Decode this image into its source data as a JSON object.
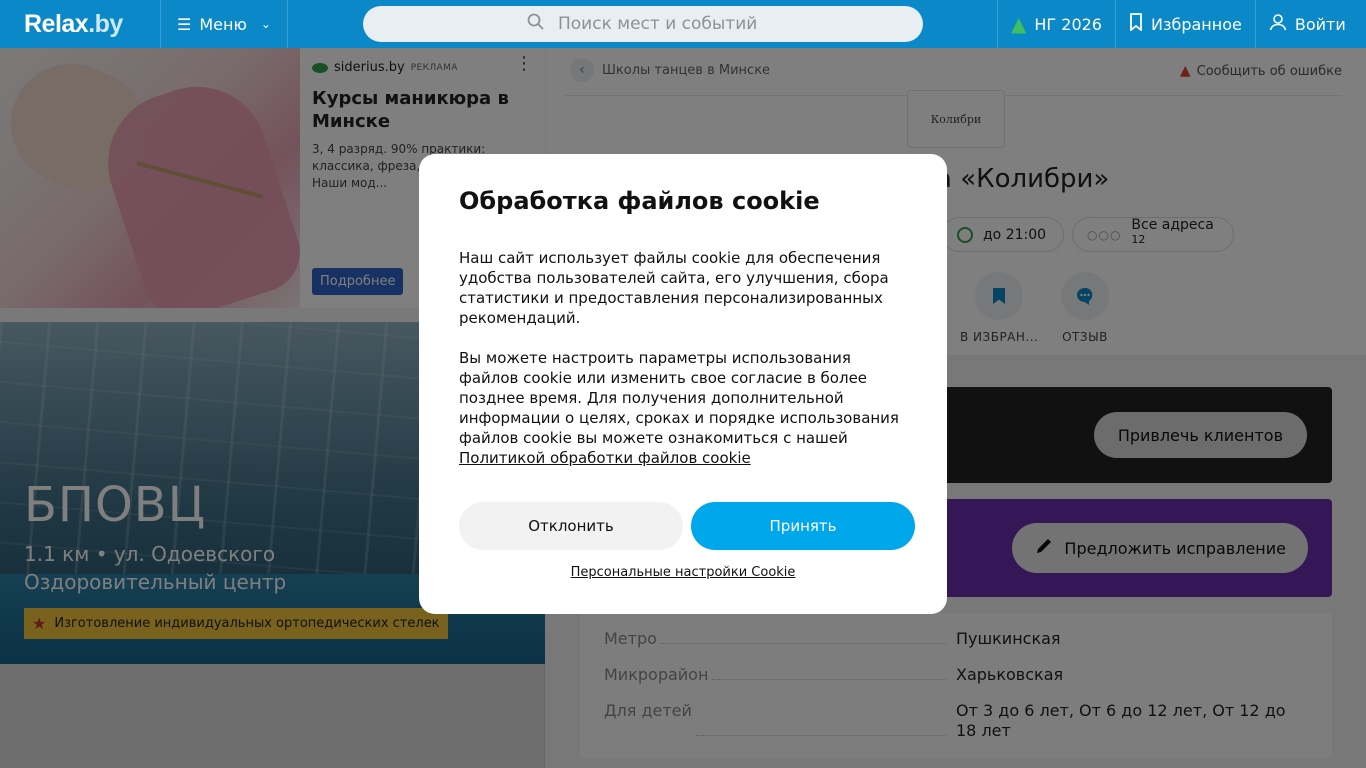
{
  "header": {
    "logo": "Relax",
    "logo_suffix": ".by",
    "menu_label": "Меню",
    "search_placeholder": "Поиск мест и событий",
    "ng_label": "НГ 2026",
    "favorites_label": "Избранное",
    "login_label": "Войти"
  },
  "ad": {
    "source": "siderius.by",
    "tag": "РЕКЛАМА",
    "title": "Курсы маникюра в Минске",
    "text": "3, 4 разряд. 90% практики: классика, фреза, п... группы. Наши мод...",
    "button": "Подробнее"
  },
  "promo": {
    "title": "БПОВЦ",
    "line1": "1.1 км • ул. Одоевского",
    "line2": "Оздоровительный центр",
    "badge": "Изготовление индивидуальных ортопедических стелек"
  },
  "place": {
    "breadcrumb": "Школы танцев в Минске",
    "report": "Сообщить об ошибке",
    "logo_text": "Колибри",
    "title_visible": "а «Колибри»",
    "hours": "до 21:00",
    "addresses_label": "Все адреса",
    "addresses_count": "12",
    "action_fav": "В ИЗБРАН...",
    "action_review": "ОТЗЫВ",
    "attract_button": "Привлечь клиентов",
    "suggest_button": "Предложить исправление",
    "info": [
      {
        "key": "Метро",
        "value": "Пушкинская"
      },
      {
        "key": "Микрорайон",
        "value": "Харьковская"
      },
      {
        "key": "Для детей",
        "value": "От 3 до 6 лет, От 6 до 12 лет, От 12 до 18 лет"
      }
    ]
  },
  "cookie": {
    "title": "Обработка файлов cookie",
    "paragraph1": "Наш сайт использует файлы cookie для обеспечения удобства пользователей сайта, его улучшения, сбора статистики и предоставления персонализированных рекомендаций.",
    "paragraph2": "Вы можете настроить параметры использования файлов cookie или изменить свое согласие в более позднее время. Для получения дополнительной информации о целях, сроках и порядке использования файлов cookie вы можете ознакомиться с нашей",
    "policy_link": "Политикой обработки файлов cookie",
    "decline": "Отклонить",
    "accept": "Принять",
    "personal": "Персональные настройки Cookie"
  }
}
